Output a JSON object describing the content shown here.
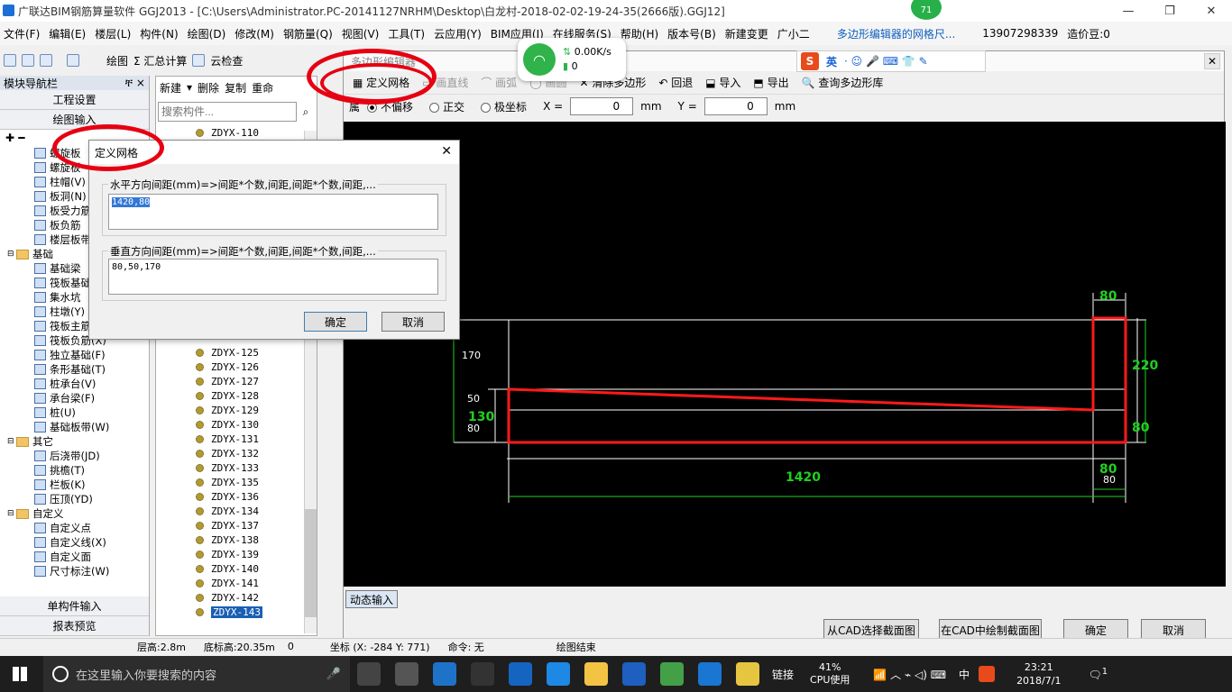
{
  "window": {
    "title": "广联达BIM钢筋算量软件 GGJ2013 - [C:\\Users\\Administrator.PC-20141127NRHM\\Desktop\\白龙村-2018-02-02-19-24-35(2666版).GGJ12]"
  },
  "menu": [
    "文件(F)",
    "编辑(E)",
    "楼层(L)",
    "构件(N)",
    "绘图(D)",
    "修改(M)",
    "钢筋量(Q)",
    "视图(V)",
    "工具(T)",
    "云应用(Y)",
    "BIM应用(I)",
    "在线服务(S)",
    "帮助(H)",
    "版本号(B)",
    "新建变更",
    "广小二",
    "多边形编辑器的网格尺...",
    "13907298339",
    "造价豆:0"
  ],
  "network": {
    "speed": "0.00K/s",
    "count": "0",
    "badge": "71"
  },
  "toolbar1": [
    "绘图",
    "Σ 汇总计算",
    "云检查"
  ],
  "leftnav": {
    "header": "模块导航栏",
    "pin": "ቸ ×",
    "buttons": [
      "工程设置",
      "绘图输入"
    ],
    "bottom_buttons": [
      "单构件输入",
      "报表预览"
    ],
    "tree": [
      {
        "label": "螺旋板",
        "folder": false
      },
      {
        "label": "螺旋板",
        "folder": false
      },
      {
        "label": "柱帽(V)",
        "folder": false
      },
      {
        "label": "板洞(N)",
        "folder": false
      },
      {
        "label": "板受力筋",
        "folder": false
      },
      {
        "label": "板负筋",
        "folder": false
      },
      {
        "label": "楼层板带",
        "folder": false
      },
      {
        "label": "基础",
        "folder": true
      },
      {
        "label": "基础梁",
        "folder": false
      },
      {
        "label": "筏板基础",
        "folder": false
      },
      {
        "label": "集水坑",
        "folder": false
      },
      {
        "label": "柱墩(Y)",
        "folder": false
      },
      {
        "label": "筏板主筋",
        "folder": false
      },
      {
        "label": "筏板负筋(X)",
        "folder": false
      },
      {
        "label": "独立基础(F)",
        "folder": false
      },
      {
        "label": "条形基础(T)",
        "folder": false
      },
      {
        "label": "桩承台(V)",
        "folder": false
      },
      {
        "label": "承台梁(F)",
        "folder": false
      },
      {
        "label": "桩(U)",
        "folder": false
      },
      {
        "label": "基础板带(W)",
        "folder": false
      },
      {
        "label": "其它",
        "folder": true
      },
      {
        "label": "后浇带(JD)",
        "folder": false
      },
      {
        "label": "挑檐(T)",
        "folder": false
      },
      {
        "label": "栏板(K)",
        "folder": false
      },
      {
        "label": "压顶(YD)",
        "folder": false
      },
      {
        "label": "自定义",
        "folder": true
      },
      {
        "label": "自定义点",
        "folder": false
      },
      {
        "label": "自定义线(X)",
        "folder": false
      },
      {
        "label": "自定义面",
        "folder": false
      },
      {
        "label": "尺寸标注(W)",
        "folder": false
      }
    ]
  },
  "midpanel": {
    "toolbar": [
      "新建",
      "删除",
      "复制",
      "重命"
    ],
    "search_placeholder": "搜索构件...",
    "top_item": "ZDYX-110",
    "items": [
      "ZDYX-125",
      "ZDYX-126",
      "ZDYX-127",
      "ZDYX-128",
      "ZDYX-129",
      "ZDYX-130",
      "ZDYX-131",
      "ZDYX-132",
      "ZDYX-133",
      "ZDYX-135",
      "ZDYX-136",
      "ZDYX-134",
      "ZDYX-137",
      "ZDYX-138",
      "ZDYX-139",
      "ZDYX-140",
      "ZDYX-141",
      "ZDYX-142",
      "ZDYX-143"
    ],
    "selected": "ZDYX-143"
  },
  "editor": {
    "title": "多边形编辑器",
    "tools": [
      "定义网格",
      "画直线",
      "画弧",
      "画圆",
      "清除多边形",
      "回退",
      "导入",
      "导出",
      "查询多边形库"
    ],
    "prop_label": "属",
    "options": [
      "不偏移",
      "正交",
      "极坐标"
    ],
    "x_label": "X =",
    "x_value": "0",
    "y_label": "Y =",
    "y_value": "0",
    "unit": "mm",
    "dynamic_input": "动态输入",
    "buttons": [
      "从CAD选择截面图",
      "在CAD中绘制截面图",
      "确定",
      "取消"
    ],
    "dims": {
      "left_170": "170",
      "left_50": "50",
      "left_130": "130",
      "left_80": "80",
      "top_80": "80",
      "right_220": "220",
      "right_80": "80",
      "bottom_1420": "1420",
      "bottom_80": "80",
      "bottom_80_small": "80"
    }
  },
  "ime": {
    "lang": "英"
  },
  "dialog": {
    "title": "定义网格",
    "h_label": "水平方向间距(mm)=>间距*个数,间距,间距*个数,间距,...",
    "h_value": "1420,80",
    "v_label": "垂直方向间距(mm)=>间距*个数,间距,间距*个数,间距,...",
    "v_value": "80,50,170",
    "ok": "确定",
    "cancel": "取消"
  },
  "status": {
    "floor_height": "层高:2.8m",
    "base_height": "底标高:20.35m",
    "zero": "0",
    "coord": "坐标 (X: -284 Y: 771)",
    "cmd": "命令: 无",
    "draw": "绘图结束"
  },
  "taskbar": {
    "search": "在这里输入你要搜索的内容",
    "link": "链接",
    "cpu": "41%",
    "cpu_label": "CPU使用",
    "ime": "中",
    "time": "23:21",
    "date": "2018/7/1",
    "notif": "1"
  },
  "colors": {
    "poly": "#ff1a1a",
    "dim_green": "#20d020",
    "grid": "#ffffff"
  }
}
